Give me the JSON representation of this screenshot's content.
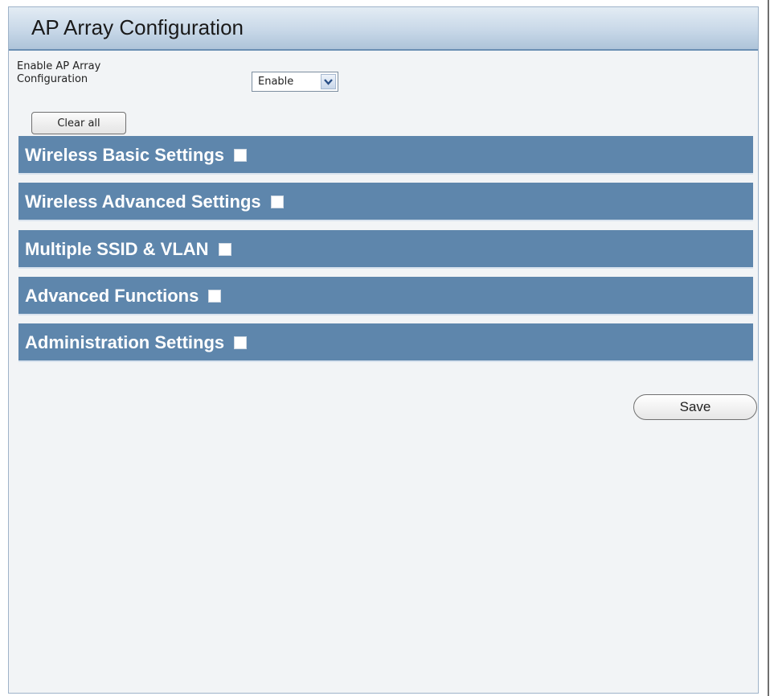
{
  "panel": {
    "title": "AP Array Configuration"
  },
  "enable": {
    "label": "Enable AP Array Configuration",
    "selected": "Enable"
  },
  "buttons": {
    "clear_all": "Clear all",
    "save": "Save"
  },
  "sections": [
    {
      "label": "Wireless Basic Settings",
      "checked": false
    },
    {
      "label": "Wireless Advanced Settings",
      "checked": false
    },
    {
      "label": "Multiple SSID & VLAN",
      "checked": false
    },
    {
      "label": "Advanced Functions",
      "checked": false
    },
    {
      "label": "Administration Settings",
      "checked": false
    }
  ],
  "colors": {
    "section_bar": "#5e86ac",
    "header_gradient_bottom": "#aec4d9",
    "panel_background": "#f2f4f6"
  },
  "icons": {
    "dropdown": "chevron-down-icon"
  }
}
